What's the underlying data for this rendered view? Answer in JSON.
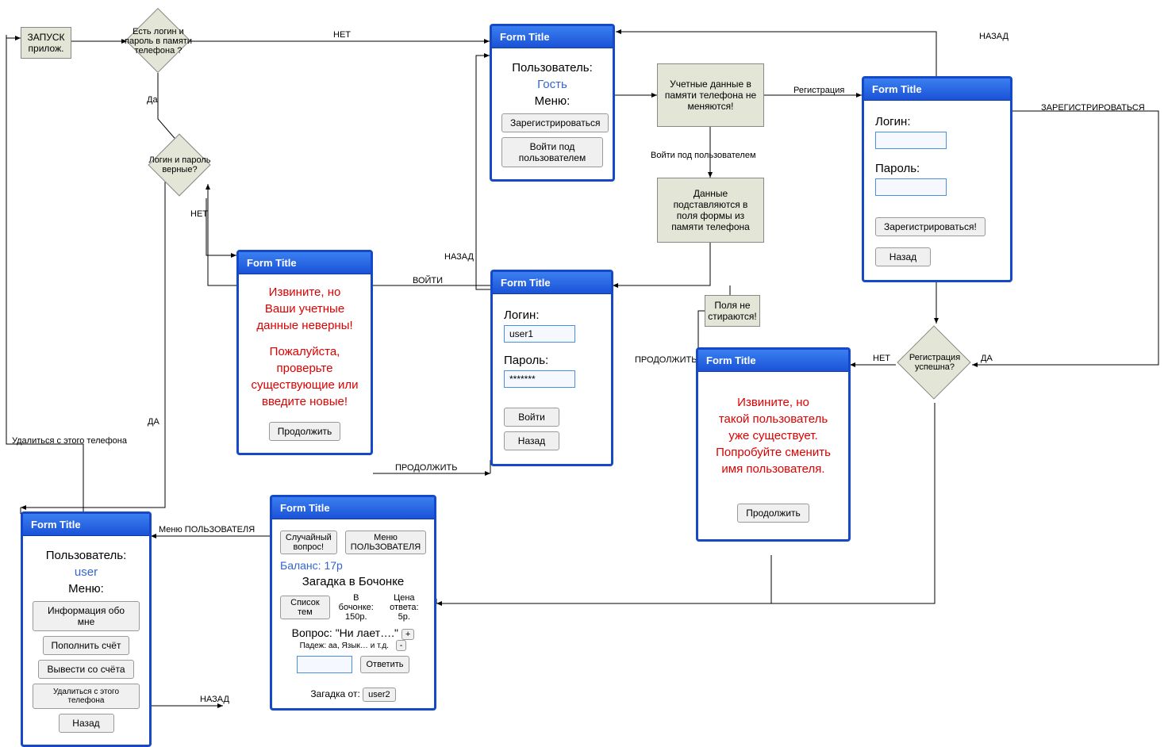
{
  "start": {
    "label": "ЗАПУСК\nприлож."
  },
  "d1": {
    "text": "Есть логин и пароль в памяти телефона ?"
  },
  "d2": {
    "text": "Логин и пароль верные?"
  },
  "d3": {
    "text": "Регистрация успешна?"
  },
  "edge": {
    "net1": "НЕТ",
    "da1": "Да",
    "net2": "НЕТ",
    "da2": "ДА",
    "nazad": "НАЗАД",
    "voiti": "ВОЙТИ",
    "prodolzhit": "ПРОДОЛЖИТЬ",
    "menu_user": "Меню ПОЛЬЗОВАТЕЛЯ",
    "nazad2": "НАЗАД",
    "udalitsya": "Удалиться с этого телефона",
    "reg": "Регистрация",
    "voiti_pod": "Войти под пользователем",
    "zareg": "ЗАРЕГИСТРИРОВАТЬСЯ",
    "net3": "НЕТ",
    "da3": "ДА"
  },
  "note1": {
    "text": "Учетные данные в памяти телефона не меняются!"
  },
  "note2": {
    "text": "Данные подставляются в поля формы из памяти телефона"
  },
  "note3": {
    "text": "Поля не стираются!"
  },
  "form_guest": {
    "title": "Form Title",
    "user_label": "Пользователь:",
    "user_value": "Гость",
    "menu_label": "Меню:",
    "btn_register": "Зарегистрироваться",
    "btn_login_as": "Войти под пользователем"
  },
  "form_error": {
    "title": "Form Title",
    "l1": "Извините, но",
    "l2": "Ваши учетные",
    "l3": "данные неверны!",
    "l4": "Пожалуйста,",
    "l5": "проверьте",
    "l6": "существующие или",
    "l7": "введите новые!",
    "btn": "Продолжить"
  },
  "form_login": {
    "title": "Form Title",
    "login_label": "Логин:",
    "login_value": "user1",
    "pass_label": "Пароль:",
    "pass_value": "*******",
    "btn_enter": "Войти",
    "btn_back": "Назад"
  },
  "form_reg": {
    "title": "Form Title",
    "login_label": "Логин:",
    "pass_label": "Пароль:",
    "btn_register": "Зарегистрироваться!",
    "btn_back": "Назад"
  },
  "form_exists": {
    "title": "Form Title",
    "l1": "Извините, но",
    "l2": "такой пользователь",
    "l3": "уже существует.",
    "l4": "Попробуйте сменить",
    "l5": "имя пользователя.",
    "btn": "Продолжить"
  },
  "form_user": {
    "title": "Form Title",
    "user_label": "Пользователь:",
    "user_value": "user",
    "menu_label": "Меню:",
    "btn_info": "Информация обо мне",
    "btn_topup": "Пополнить счёт",
    "btn_withdraw": "Вывести со счёта",
    "btn_delete": "Удалиться с этого телефона",
    "btn_back": "Назад"
  },
  "form_game": {
    "title": "Form Title",
    "btn_random": "Случайный вопрос!",
    "btn_menu": "Меню ПОЛЬЗОВАТЕЛЯ",
    "balance": "Баланс: 17р",
    "heading": "Загадка в Бочонке",
    "btn_topics": "Список тем",
    "barrel_label": "В бочонке:",
    "barrel_value": "150р.",
    "answer_price_label": "Цена ответа:",
    "answer_price_value": "5р.",
    "question_label": "Вопрос:",
    "question_text": "\"Ни лает….\"",
    "hint": "Падеж: аа, Язык… и т.д.",
    "btn_plus": "+",
    "btn_minus": "-",
    "btn_answer": "Ответить",
    "from_label": "Загадка от:",
    "from_value": "user2"
  }
}
